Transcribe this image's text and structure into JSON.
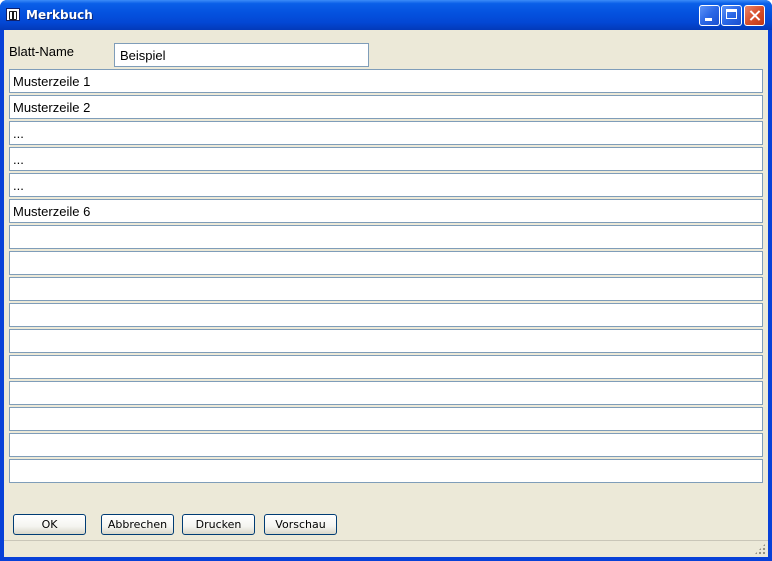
{
  "window": {
    "title": "Merkbuch"
  },
  "form": {
    "sheet_name_label": "Blatt-Name",
    "sheet_name_value": "Beispiel",
    "lines": [
      "Musterzeile 1",
      "Musterzeile 2",
      "...",
      "...",
      "...",
      "Musterzeile 6",
      "",
      "",
      "",
      "",
      "",
      "",
      "",
      "",
      "",
      ""
    ]
  },
  "buttons": {
    "ok": "OK",
    "cancel": "Abbrechen",
    "print": "Drucken",
    "preview": "Vorschau"
  }
}
